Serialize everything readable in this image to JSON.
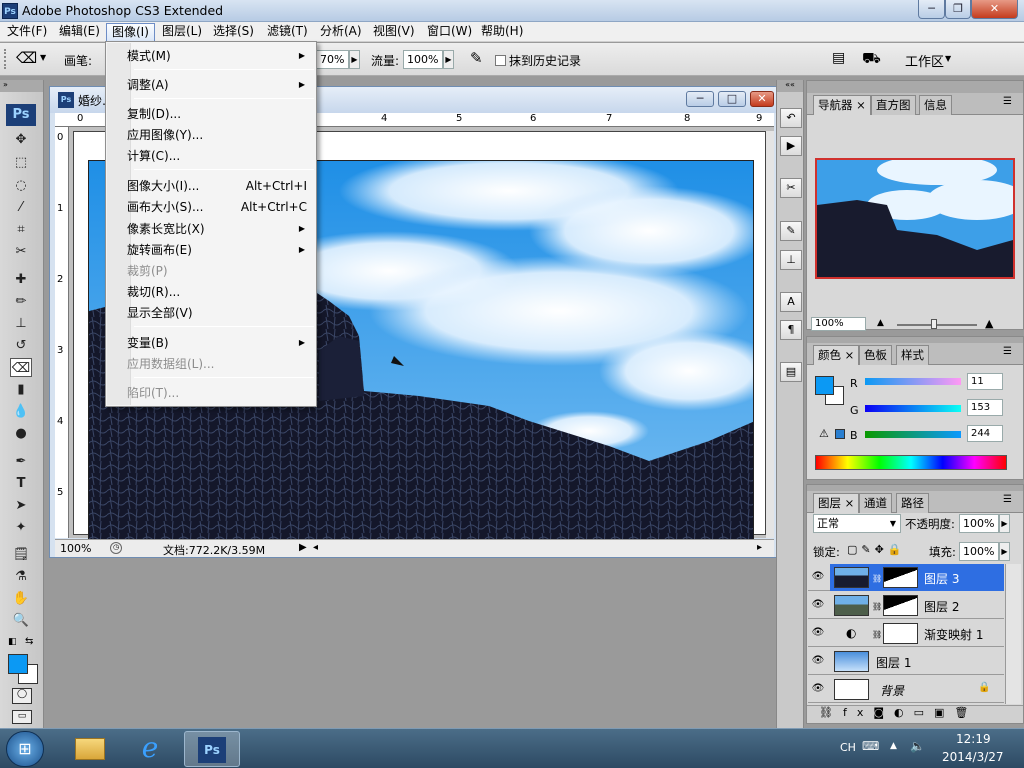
{
  "window": {
    "title": "Adobe Photoshop CS3 Extended",
    "min": "─",
    "max": "❐",
    "close": "✕"
  },
  "menubar": [
    "文件(F)",
    "编辑(E)",
    "图像(I)",
    "图层(L)",
    "选择(S)",
    "滤镜(T)",
    "分析(A)",
    "视图(V)",
    "窗口(W)",
    "帮助(H)"
  ],
  "options": {
    "brush_label": "画笔:",
    "opacity_value": "70%",
    "flow_label": "流量:",
    "flow_value": "100%",
    "erase_history": "抹到历史记录",
    "workspace": "工作区"
  },
  "image_menu": {
    "items": [
      {
        "label": "模式(M)",
        "sub": true
      },
      {
        "label": "调整(A)",
        "sub": true
      },
      {
        "label": "复制(D)..."
      },
      {
        "label": "应用图像(Y)..."
      },
      {
        "label": "计算(C)..."
      },
      {
        "label": "图像大小(I)...",
        "shortcut": "Alt+Ctrl+I"
      },
      {
        "label": "画布大小(S)...",
        "shortcut": "Alt+Ctrl+C"
      },
      {
        "label": "像素长宽比(X)",
        "sub": true
      },
      {
        "label": "旋转画布(E)",
        "sub": true
      },
      {
        "label": "裁剪(P)",
        "disabled": true
      },
      {
        "label": "裁切(R)..."
      },
      {
        "label": "显示全部(V)"
      },
      {
        "label": "变量(B)",
        "sub": true
      },
      {
        "label": "应用数据组(L)...",
        "disabled": true
      },
      {
        "label": "陷印(T)...",
        "disabled": true
      }
    ]
  },
  "document": {
    "title": "婚纱…",
    "zoom": "100%",
    "doc_info": "文档:772.2K/3.59M",
    "ruler_top": [
      "0",
      "4",
      "5",
      "6",
      "7",
      "8",
      "9"
    ],
    "ruler_left": [
      "0",
      "1",
      "2",
      "3",
      "4",
      "5"
    ]
  },
  "navigator": {
    "tabs": [
      "导航器",
      "直方图",
      "信息"
    ],
    "zoom": "100%"
  },
  "color": {
    "tabs": [
      "颜色",
      "色板",
      "样式"
    ],
    "r_label": "R",
    "g_label": "G",
    "b_label": "B",
    "r": "11",
    "g": "153",
    "b": "244",
    "fg": "#0b99f4"
  },
  "layers": {
    "tabs": [
      "图层",
      "通道",
      "路径"
    ],
    "blend": "正常",
    "opacity_label": "不透明度:",
    "opacity": "100%",
    "lock_label": "锁定:",
    "fill_label": "填充:",
    "fill": "100%",
    "rows": [
      {
        "name": "图层 3",
        "selected": true
      },
      {
        "name": "图层 2"
      },
      {
        "name": "渐变映射 1"
      },
      {
        "name": "图层 1"
      },
      {
        "name": "背景"
      }
    ]
  },
  "taskbar": {
    "ime": "CH",
    "time": "12:19",
    "date": "2014/3/27"
  }
}
